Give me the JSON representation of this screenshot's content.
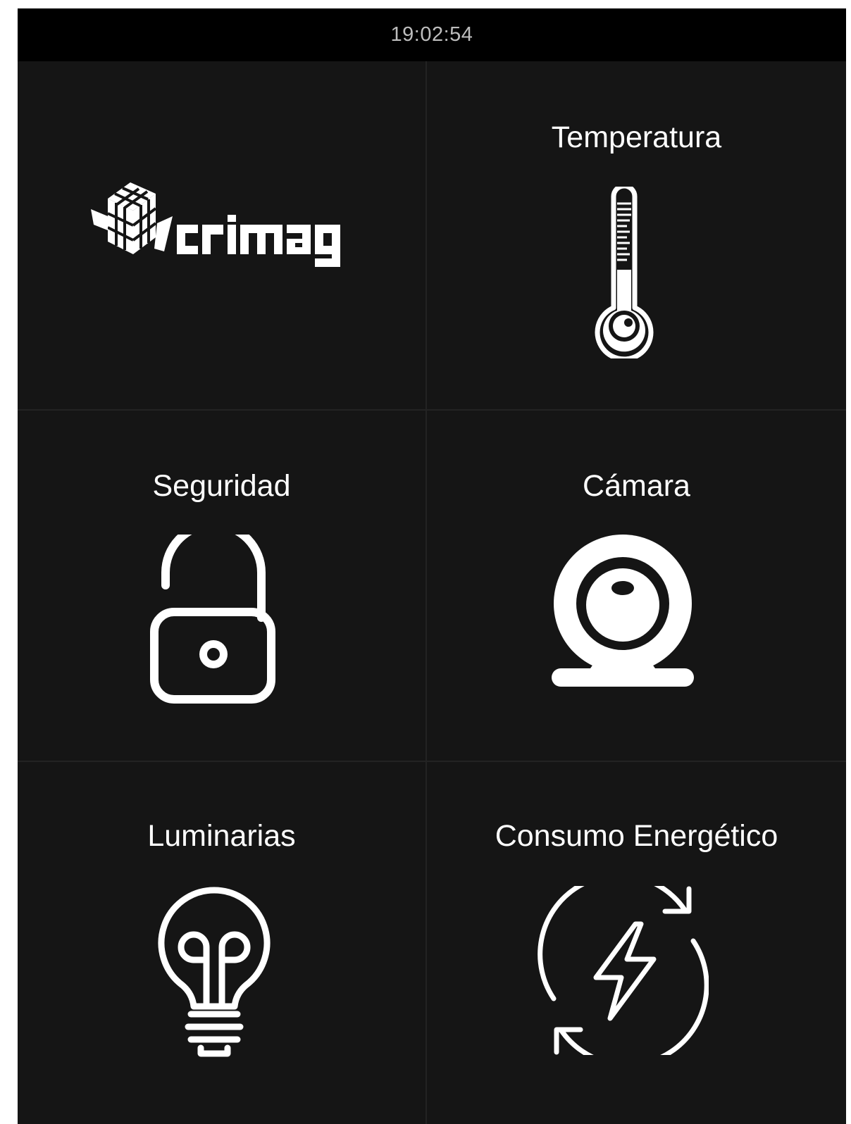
{
  "status_bar": {
    "time": "19:02:54"
  },
  "tiles": [
    {
      "id": "logo",
      "label": "",
      "icon": "crimag-cube-logo",
      "logo_text": "crimag"
    },
    {
      "id": "temperatura",
      "label": "Temperatura",
      "icon": "thermometer-icon"
    },
    {
      "id": "seguridad",
      "label": "Seguridad",
      "icon": "unlocked-padlock-icon"
    },
    {
      "id": "camara",
      "label": "Cámara",
      "icon": "webcam-icon"
    },
    {
      "id": "luminarias",
      "label": "Luminarias",
      "icon": "lightbulb-icon"
    },
    {
      "id": "consumo",
      "label": "Consumo Energético",
      "icon": "energy-cycle-icon"
    }
  ],
  "colors": {
    "background": "#151515",
    "status_bar": "#000000",
    "status_text": "#bdbdbd",
    "foreground": "#ffffff",
    "divider": "#232323"
  }
}
